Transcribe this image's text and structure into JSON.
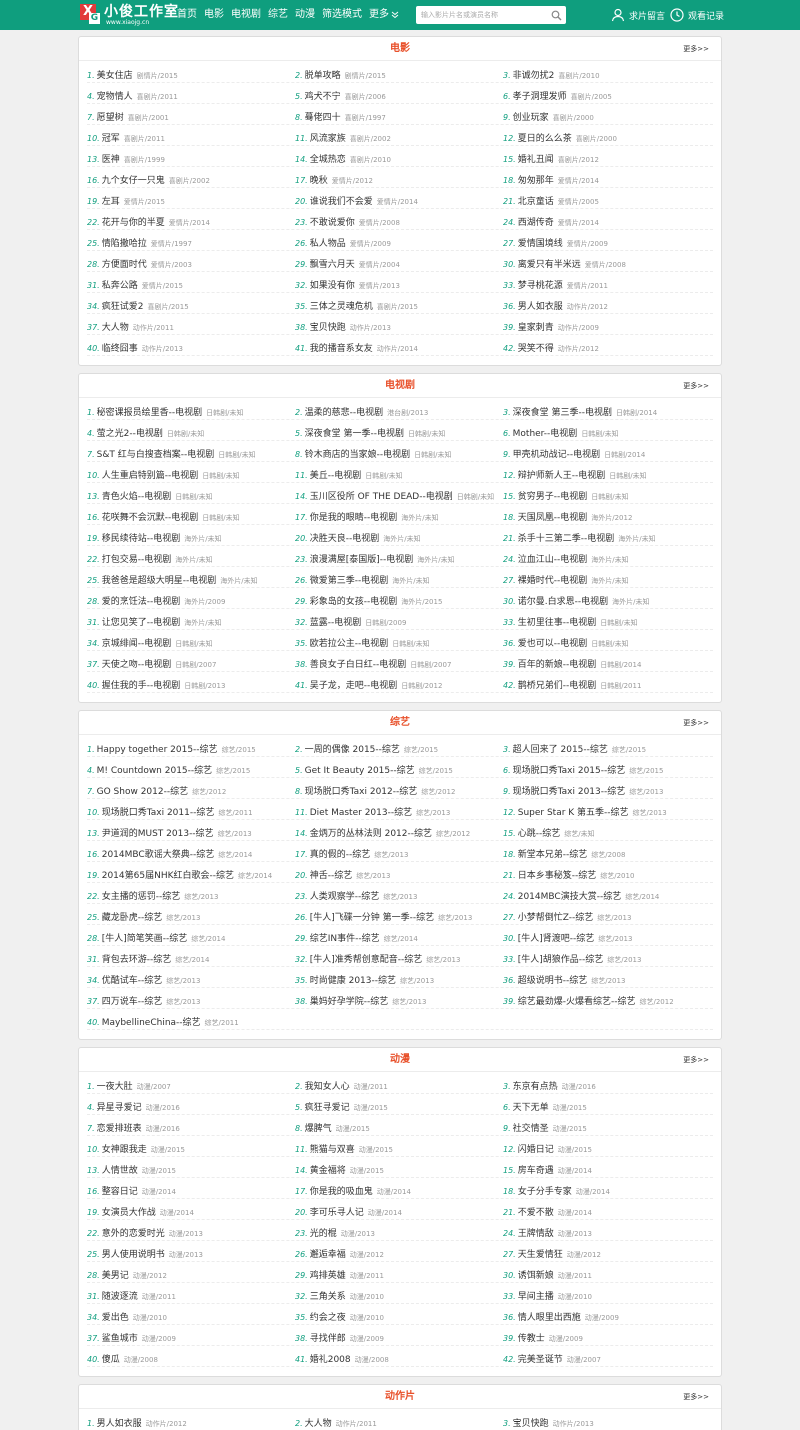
{
  "header": {
    "logo_mark": "X",
    "logo_mark_small": "G",
    "logo_name": "小俊工作室",
    "logo_domain": "www.xiaojg.cn",
    "nav": [
      "首页",
      "电影",
      "电视剧",
      "综艺",
      "动漫",
      "筛选模式",
      "更多"
    ],
    "search_placeholder": "输入影片片名或演员名称",
    "request_label": "求片留言",
    "history_label": "观看记录",
    "colors": {
      "bar": "#0f9e7e",
      "accent": "#e8502a",
      "logo_red": "#e23b3b"
    }
  },
  "sections": [
    {
      "title": "电影",
      "more": "更多>>",
      "items": [
        [
          "1.",
          "美女住店",
          "剧情片/2015"
        ],
        [
          "2.",
          "脱单攻略",
          "剧情片/2015"
        ],
        [
          "3.",
          "非诚勿扰2",
          "喜剧片/2010"
        ],
        [
          "4.",
          "宠物情人",
          "喜剧片/2011"
        ],
        [
          "5.",
          "鸡犬不宁",
          "喜剧片/2006"
        ],
        [
          "6.",
          "孝子洞理发师",
          "喜剧片/2005"
        ],
        [
          "7.",
          "愿望树",
          "喜剧片/2001"
        ],
        [
          "8.",
          "蓦佬四十",
          "喜剧片/1997"
        ],
        [
          "9.",
          "创业玩家",
          "喜剧片/2000"
        ],
        [
          "10.",
          "冠军",
          "喜剧片/2011"
        ],
        [
          "11.",
          "风流家族",
          "喜剧片/2002"
        ],
        [
          "12.",
          "夏日的么么茶",
          "喜剧片/2000"
        ],
        [
          "13.",
          "医神",
          "喜剧片/1999"
        ],
        [
          "14.",
          "全城热恋",
          "喜剧片/2010"
        ],
        [
          "15.",
          "婚礼丑闻",
          "喜剧片/2012"
        ],
        [
          "16.",
          "九个女仔一只鬼",
          "喜剧片/2002"
        ],
        [
          "17.",
          "晚秋",
          "爱情片/2012"
        ],
        [
          "18.",
          "匆匆那年",
          "爱情片/2014"
        ],
        [
          "19.",
          "左耳",
          "爱情片/2015"
        ],
        [
          "20.",
          "谁说我们不会爱",
          "爱情片/2014"
        ],
        [
          "21.",
          "北京童话",
          "爱情片/2005"
        ],
        [
          "22.",
          "花开与你的半夏",
          "爱情片/2014"
        ],
        [
          "23.",
          "不敢说爱你",
          "爱情片/2008"
        ],
        [
          "24.",
          "西湖传奇",
          "爱情片/2014"
        ],
        [
          "25.",
          "情陷撒哈拉",
          "爱情片/1997"
        ],
        [
          "26.",
          "私人物品",
          "爱情片/2009"
        ],
        [
          "27.",
          "爱情国境线",
          "爱情片/2009"
        ],
        [
          "28.",
          "方便面时代",
          "爱情片/2003"
        ],
        [
          "29.",
          "飘雪六月天",
          "爱情片/2004"
        ],
        [
          "30.",
          "离爱只有半米远",
          "爱情片/2008"
        ],
        [
          "31.",
          "私奔公路",
          "爱情片/2015"
        ],
        [
          "32.",
          "如果没有你",
          "爱情片/2013"
        ],
        [
          "33.",
          "梦寻桃花源",
          "爱情片/2011"
        ],
        [
          "34.",
          "疯狂试爱2",
          "喜剧片/2015"
        ],
        [
          "35.",
          "三体之灵魂危机",
          "喜剧片/2015"
        ],
        [
          "36.",
          "男人如衣服",
          "动作片/2012"
        ],
        [
          "37.",
          "大人物",
          "动作片/2011"
        ],
        [
          "38.",
          "宝贝快跑",
          "动作片/2013"
        ],
        [
          "39.",
          "皇家刺青",
          "动作片/2009"
        ],
        [
          "40.",
          "临终囧事",
          "动作片/2013"
        ],
        [
          "41.",
          "我的播音系女友",
          "动作片/2014"
        ],
        [
          "42.",
          "哭笑不得",
          "动作片/2012"
        ]
      ]
    },
    {
      "title": "电视剧",
      "more": "更多>>",
      "items": [
        [
          "1.",
          "秘密课报员绘里香--电视剧",
          "日韩剧/未知"
        ],
        [
          "2.",
          "温柔的慈悲--电视剧",
          "港台剧/2013"
        ],
        [
          "3.",
          "深夜食堂 第三季--电视剧",
          "日韩剧/2014"
        ],
        [
          "4.",
          "萤之光2--电视剧",
          "日韩剧/未知"
        ],
        [
          "5.",
          "深夜食堂 第一季--电视剧",
          "日韩剧/未知"
        ],
        [
          "6.",
          "Mother--电视剧",
          "日韩剧/未知"
        ],
        [
          "7.",
          "S&T 红与白搜查档案--电视剧",
          "日韩剧/未知"
        ],
        [
          "8.",
          "铃木商店的当家娘--电视剧",
          "日韩剧/未知"
        ],
        [
          "9.",
          "甲壳机动战记--电视剧",
          "日韩剧/2014"
        ],
        [
          "10.",
          "人生重启特别篇--电视剧",
          "日韩剧/未知"
        ],
        [
          "11.",
          "美丘--电视剧",
          "日韩剧/未知"
        ],
        [
          "12.",
          "辩护师新人王--电视剧",
          "日韩剧/未知"
        ],
        [
          "13.",
          "青色火焰--电视剧",
          "日韩剧/未知"
        ],
        [
          "14.",
          "玉川区役所 OF THE DEAD--电视剧",
          "日韩剧/未知"
        ],
        [
          "15.",
          "贫穷男子--电视剧",
          "日韩剧/未知"
        ],
        [
          "16.",
          "花咲舞不会沉默--电视剧",
          "日韩剧/未知"
        ],
        [
          "17.",
          "你是我的眼睛--电视剧",
          "海外片/未知"
        ],
        [
          "18.",
          "天国凤凰--电视剧",
          "海外片/2012"
        ],
        [
          "19.",
          "移民续待站--电视剧",
          "海外片/未知"
        ],
        [
          "20.",
          "决胜天良--电视剧",
          "海外片/未知"
        ],
        [
          "21.",
          "杀手十三第二季--电视剧",
          "海外片/未知"
        ],
        [
          "22.",
          "打包交易--电视剧",
          "海外片/未知"
        ],
        [
          "23.",
          "浪漫满屋[泰国版]--电视剧",
          "海外片/未知"
        ],
        [
          "24.",
          "泣血江山--电视剧",
          "海外片/未知"
        ],
        [
          "25.",
          "我爸爸是超级大明星--电视剧",
          "海外片/未知"
        ],
        [
          "26.",
          "微爱第三季--电视剧",
          "海外片/未知"
        ],
        [
          "27.",
          "裸婚时代--电视剧",
          "海外片/未知"
        ],
        [
          "28.",
          "爱的烹饪法--电视剧",
          "海外片/2009"
        ],
        [
          "29.",
          "彩象岛的女孩--电视剧",
          "海外片/2015"
        ],
        [
          "30.",
          "诺尔曼.白求恩--电视剧",
          "海外片/未知"
        ],
        [
          "31.",
          "让您见笑了--电视剧",
          "海外片/未知"
        ],
        [
          "32.",
          "蓝露--电视剧",
          "日韩剧/2009"
        ],
        [
          "33.",
          "生初里往事--电视剧",
          "日韩剧/未知"
        ],
        [
          "34.",
          "京城绯闻--电视剧",
          "日韩剧/未知"
        ],
        [
          "35.",
          "欧若拉公主--电视剧",
          "日韩剧/未知"
        ],
        [
          "36.",
          "爱也可以--电视剧",
          "日韩剧/未知"
        ],
        [
          "37.",
          "天使之吻--电视剧",
          "日韩剧/2007"
        ],
        [
          "38.",
          "善良女子白日红--电视剧",
          "日韩剧/2007"
        ],
        [
          "39.",
          "百年的新娘--电视剧",
          "日韩剧/2014"
        ],
        [
          "40.",
          "握住我的手--电视剧",
          "日韩剧/2013"
        ],
        [
          "41.",
          "吴子龙，走吧--电视剧",
          "日韩剧/2012"
        ],
        [
          "42.",
          "鹊桥兄弟们--电视剧",
          "日韩剧/2011"
        ]
      ]
    },
    {
      "title": "综艺",
      "more": "更多>>",
      "items": [
        [
          "1.",
          "Happy together 2015--综艺",
          "综艺/2015"
        ],
        [
          "2.",
          "一周的偶像 2015--综艺",
          "综艺/2015"
        ],
        [
          "3.",
          "超人回来了 2015--综艺",
          "综艺/2015"
        ],
        [
          "4.",
          "M! Countdown 2015--综艺",
          "综艺/2015"
        ],
        [
          "5.",
          "Get It Beauty 2015--综艺",
          "综艺/2015"
        ],
        [
          "6.",
          "现场脱口秀Taxi 2015--综艺",
          "综艺/2015"
        ],
        [
          "7.",
          "GO Show 2012--综艺",
          "综艺/2012"
        ],
        [
          "8.",
          "现场脱口秀Taxi 2012--综艺",
          "综艺/2012"
        ],
        [
          "9.",
          "现场脱口秀Taxi 2013--综艺",
          "综艺/2013"
        ],
        [
          "10.",
          "现场脱口秀Taxi 2011--综艺",
          "综艺/2011"
        ],
        [
          "11.",
          "Diet Master 2013--综艺",
          "综艺/2013"
        ],
        [
          "12.",
          "Super Star K 第五季--综艺",
          "综艺/2013"
        ],
        [
          "13.",
          "尹道润的MUST 2013--综艺",
          "综艺/2013"
        ],
        [
          "14.",
          "金炳万的丛林法则 2012--综艺",
          "综艺/2012"
        ],
        [
          "15.",
          "心跳--综艺",
          "综艺/未知"
        ],
        [
          "16.",
          "2014MBC歌谣大祭典--综艺",
          "综艺/2014"
        ],
        [
          "17.",
          "真的假的--综艺",
          "综艺/2013"
        ],
        [
          "18.",
          "新堂本兄弟--综艺",
          "综艺/2008"
        ],
        [
          "19.",
          "2014第65届NHK红白歌会--综艺",
          "综艺/2014"
        ],
        [
          "20.",
          "神舌--综艺",
          "综艺/2013"
        ],
        [
          "21.",
          "日本乡事秘笈--综艺",
          "综艺/2010"
        ],
        [
          "22.",
          "女主播的惩罚--综艺",
          "综艺/2013"
        ],
        [
          "23.",
          "人类观察学--综艺",
          "综艺/2013"
        ],
        [
          "24.",
          "2014MBC演技大赏--综艺",
          "综艺/2014"
        ],
        [
          "25.",
          "藏龙卧虎--综艺",
          "综艺/2013"
        ],
        [
          "26.",
          "[牛人]飞碟一分钟 第一季--综艺",
          "综艺/2013"
        ],
        [
          "27.",
          "小梦帮倒忙Z--综艺",
          "综艺/2013"
        ],
        [
          "28.",
          "[牛人]简笔笑画--综艺",
          "综艺/2014"
        ],
        [
          "29.",
          "综艺IN事件--综艺",
          "综艺/2014"
        ],
        [
          "30.",
          "[牛人]肾渡吧--综艺",
          "综艺/2013"
        ],
        [
          "31.",
          "背包去环游--综艺",
          "综艺/2014"
        ],
        [
          "32.",
          "[牛人]准秀帮创意配音--综艺",
          "综艺/2013"
        ],
        [
          "33.",
          "[牛人]胡狼作品--综艺",
          "综艺/2013"
        ],
        [
          "34.",
          "优酷试车--综艺",
          "综艺/2013"
        ],
        [
          "35.",
          "时尚健康 2013--综艺",
          "综艺/2013"
        ],
        [
          "36.",
          "超级说明书--综艺",
          "综艺/2013"
        ],
        [
          "37.",
          "四万说车--综艺",
          "综艺/2013"
        ],
        [
          "38.",
          "巢妈好孕学院--综艺",
          "综艺/2013"
        ],
        [
          "39.",
          "综艺最劲爆-火爆看综艺--综艺",
          "综艺/2012"
        ],
        [
          "40.",
          "MaybellineChina--综艺",
          "综艺/2011"
        ]
      ]
    },
    {
      "title": "动漫",
      "more": "更多>>",
      "items": [
        [
          "1.",
          "一夜大肚",
          "动漫/2007"
        ],
        [
          "2.",
          "我知女人心",
          "动漫/2011"
        ],
        [
          "3.",
          "东京有点热",
          "动漫/2016"
        ],
        [
          "4.",
          "异星寻爱记",
          "动漫/2016"
        ],
        [
          "5.",
          "疯狂寻爱记",
          "动漫/2015"
        ],
        [
          "6.",
          "天下无单",
          "动漫/2015"
        ],
        [
          "7.",
          "恋爱排班表",
          "动漫/2016"
        ],
        [
          "8.",
          "爆脾气",
          "动漫/2015"
        ],
        [
          "9.",
          "社交情圣",
          "动漫/2015"
        ],
        [
          "10.",
          "女神跟我走",
          "动漫/2015"
        ],
        [
          "11.",
          "熊猫与双喜",
          "动漫/2015"
        ],
        [
          "12.",
          "闪婚日记",
          "动漫/2015"
        ],
        [
          "13.",
          "人情世故",
          "动漫/2015"
        ],
        [
          "14.",
          "黄金福将",
          "动漫/2015"
        ],
        [
          "15.",
          "房车奇遇",
          "动漫/2014"
        ],
        [
          "16.",
          "整容日记",
          "动漫/2014"
        ],
        [
          "17.",
          "你是我的吸血鬼",
          "动漫/2014"
        ],
        [
          "18.",
          "女子分手专家",
          "动漫/2014"
        ],
        [
          "19.",
          "女演员大作战",
          "动漫/2014"
        ],
        [
          "20.",
          "李可乐寻人记",
          "动漫/2014"
        ],
        [
          "21.",
          "不爱不散",
          "动漫/2014"
        ],
        [
          "22.",
          "意外的恋爱时光",
          "动漫/2013"
        ],
        [
          "23.",
          "光的棍",
          "动漫/2013"
        ],
        [
          "24.",
          "王牌情敌",
          "动漫/2013"
        ],
        [
          "25.",
          "男人使用说明书",
          "动漫/2013"
        ],
        [
          "26.",
          "邂逅幸福",
          "动漫/2012"
        ],
        [
          "27.",
          "天生爱情狂",
          "动漫/2012"
        ],
        [
          "28.",
          "美男记",
          "动漫/2012"
        ],
        [
          "29.",
          "鸡排英雄",
          "动漫/2011"
        ],
        [
          "30.",
          "诱饵新娘",
          "动漫/2011"
        ],
        [
          "31.",
          "随波逐流",
          "动漫/2011"
        ],
        [
          "32.",
          "三角关系",
          "动漫/2010"
        ],
        [
          "33.",
          "早间主播",
          "动漫/2010"
        ],
        [
          "34.",
          "爱出色",
          "动漫/2010"
        ],
        [
          "35.",
          "约会之夜",
          "动漫/2010"
        ],
        [
          "36.",
          "情人眼里出西施",
          "动漫/2009"
        ],
        [
          "37.",
          "鲨鱼城市",
          "动漫/2009"
        ],
        [
          "38.",
          "寻找伴郎",
          "动漫/2009"
        ],
        [
          "39.",
          "传教士",
          "动漫/2009"
        ],
        [
          "40.",
          "傻瓜",
          "动漫/2008"
        ],
        [
          "41.",
          "婚礼2008",
          "动漫/2008"
        ],
        [
          "42.",
          "完美圣诞节",
          "动漫/2007"
        ]
      ]
    },
    {
      "title": "动作片",
      "more": "更多>>",
      "items": [
        [
          "1.",
          "男人如衣服",
          "动作片/2012"
        ],
        [
          "2.",
          "大人物",
          "动作片/2011"
        ],
        [
          "3.",
          "宝贝快跑",
          "动作片/2013"
        ]
      ]
    }
  ]
}
